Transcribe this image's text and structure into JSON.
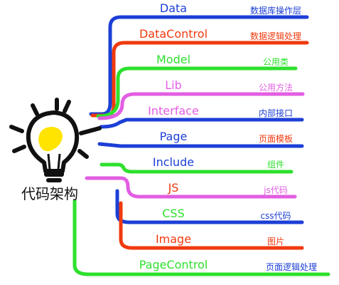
{
  "root": {
    "label": "代码架构"
  },
  "colors": {
    "blue": "#1c3fd6",
    "red": "#f03a0e",
    "green": "#2ee02e",
    "magenta": "#e25ee2",
    "bulb": "#ffe400",
    "ink": "#111111"
  },
  "branches": [
    {
      "label": "Data",
      "desc": "数据库操作层",
      "color": "#1c3fd6"
    },
    {
      "label": "DataControl",
      "desc": "数据逻辑处理",
      "color": "#f03a0e"
    },
    {
      "label": "Model",
      "desc": "公用类",
      "color": "#2ee02e"
    },
    {
      "label": "Lib",
      "desc": "公用方法",
      "color": "#e25ee2"
    },
    {
      "label": "Interface",
      "desc": "内部接口",
      "color": "#1c3fd6"
    },
    {
      "label": "Page",
      "desc": "页面模板",
      "color": "#1c3fd6"
    },
    {
      "label": "Include",
      "desc": "组件",
      "color": "#1c3fd6"
    },
    {
      "label": "JS",
      "desc": "js代码",
      "color": "#f03a0e"
    },
    {
      "label": "CSS",
      "desc": "css代码",
      "color": "#2ee02e"
    },
    {
      "label": "Image",
      "desc": "图片",
      "color": "#f03a0e"
    },
    {
      "label": "PageControl",
      "desc": "页面逻辑处理",
      "color": "#2ee02e"
    }
  ]
}
